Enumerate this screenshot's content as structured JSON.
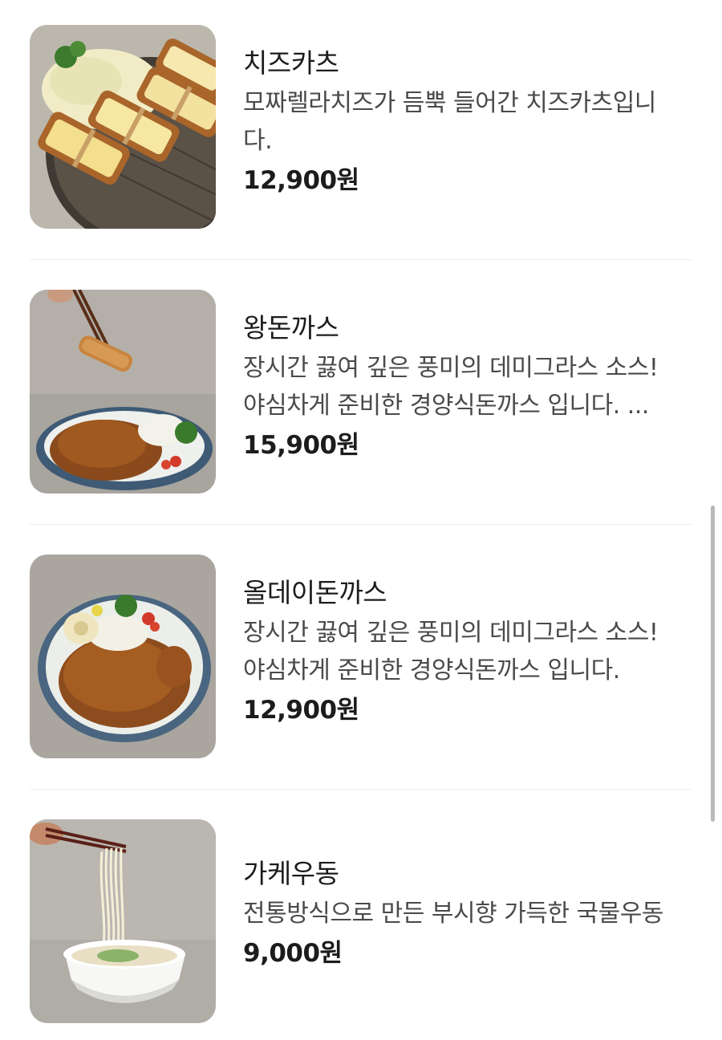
{
  "menu": {
    "items": [
      {
        "name": "치즈카츠",
        "desc_lines": [
          "모짜렐라치즈가 듬뿍 들어간 치즈카츠입니",
          "다."
        ],
        "price": "12,900원",
        "image_icon": "cheese-katsu-photo"
      },
      {
        "name": "왕돈까스",
        "desc_lines": [
          "장시간 끓여 깊은 풍미의 데미그라스 소스!",
          "야심차게 준비한 경양식돈까스 입니다. ..."
        ],
        "price": "15,900원",
        "image_icon": "wang-donkatsu-photo"
      },
      {
        "name": "올데이돈까스",
        "desc_lines": [
          "장시간 끓여 깊은 풍미의 데미그라스 소스!",
          "야심차게 준비한 경양식돈까스 입니다."
        ],
        "price": "12,900원",
        "image_icon": "allday-donkatsu-photo"
      },
      {
        "name": "가케우동",
        "desc_lines": [
          "전통방식으로 만든 부시향 가득한 국물우동"
        ],
        "price": "9,000원",
        "image_icon": "kake-udon-photo"
      }
    ]
  },
  "colors": {
    "text_primary": "#1c1c1c",
    "text_secondary": "#4a4a4a",
    "divider": "#eeeeee",
    "scrollbar": "#b9b9b9"
  }
}
